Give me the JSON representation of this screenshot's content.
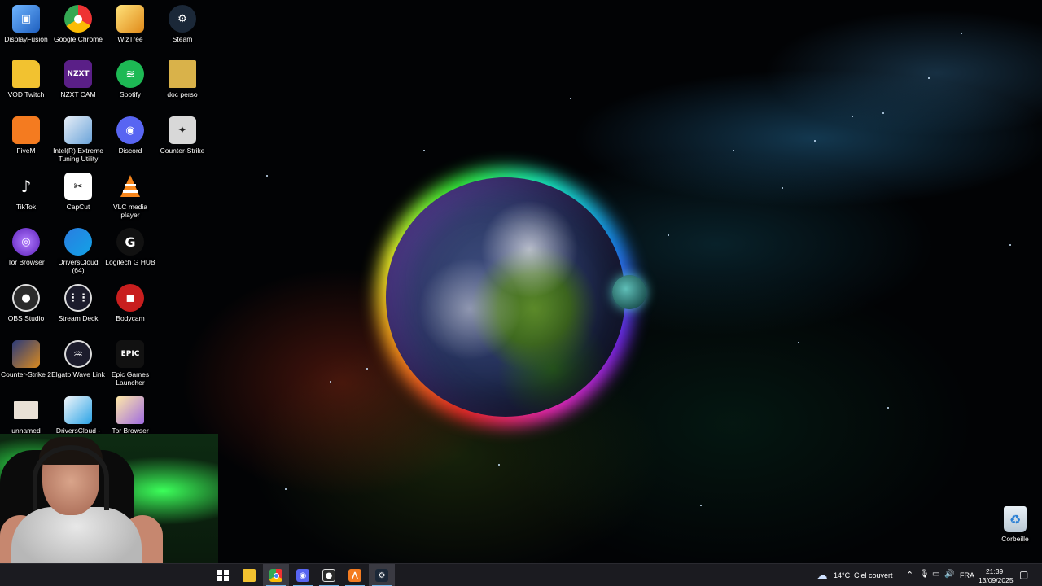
{
  "desktop_icons": [
    {
      "label": "DisplayFusion",
      "icon": "displayfusion-icon"
    },
    {
      "label": "VOD Twitch",
      "icon": "folder-icon"
    },
    {
      "label": "FiveM",
      "icon": "fivem-icon"
    },
    {
      "label": "TikTok",
      "icon": "tiktok-icon"
    },
    {
      "label": "Tor Browser",
      "icon": "tor-browser-icon"
    },
    {
      "label": "OBS Studio",
      "icon": "obs-icon"
    },
    {
      "label": "Counter-Strike 2",
      "icon": "cs2-icon"
    },
    {
      "label": "unnamed",
      "icon": "image-file-icon"
    },
    {
      "label": "Google Chrome",
      "icon": "chrome-icon"
    },
    {
      "label": "NZXT CAM",
      "icon": "nzxt-icon",
      "text": "NZXT"
    },
    {
      "label": "Intel(R) Extreme Tuning Utility",
      "icon": "intel-xtu-icon"
    },
    {
      "label": "CapCut",
      "icon": "capcut-icon"
    },
    {
      "label": "DriversCloud (64)",
      "icon": "driverscloud-icon"
    },
    {
      "label": "Stream Deck",
      "icon": "stream-deck-icon"
    },
    {
      "label": "Elgato Wave Link",
      "icon": "wave-link-icon"
    },
    {
      "label": "DriversCloud - Start the det...",
      "icon": "driverscloud-shortcut-icon"
    },
    {
      "label": "WizTree",
      "icon": "wiztree-icon"
    },
    {
      "label": "Spotify",
      "icon": "spotify-icon"
    },
    {
      "label": "Discord",
      "icon": "discord-icon"
    },
    {
      "label": "VLC media player",
      "icon": "vlc-icon"
    },
    {
      "label": "Logitech G HUB",
      "icon": "logitech-ghub-icon",
      "text": "G"
    },
    {
      "label": "Bodycam",
      "icon": "bodycam-icon"
    },
    {
      "label": "Epic Games Launcher",
      "icon": "epic-games-icon",
      "text": "EPIC"
    },
    {
      "label": "Tor Browser",
      "icon": "tor-browser-file-icon"
    },
    {
      "label": "Steam",
      "icon": "steam-icon"
    },
    {
      "label": "doc perso",
      "icon": "folder-zip-icon"
    },
    {
      "label": "Counter-Strike",
      "icon": "counter-strike-icon"
    }
  ],
  "recycle_bin": {
    "label": "Corbeille",
    "icon": "recycle-bin-icon"
  },
  "taskbar": {
    "apps": [
      {
        "icon": "windows-start-icon"
      },
      {
        "icon": "file-explorer-icon"
      },
      {
        "icon": "chrome-icon",
        "active": true
      },
      {
        "icon": "discord-icon"
      },
      {
        "icon": "obs-icon"
      },
      {
        "icon": "fivem-icon"
      },
      {
        "icon": "steam-icon",
        "active": true
      }
    ],
    "weather": {
      "temp": "14°C",
      "condition": "Ciel couvert",
      "icon": "cloudy-weather-icon"
    },
    "language": "FRA",
    "time": "21:39",
    "date": "13/09/2025"
  },
  "colors": {
    "taskbar_bg": "#1b1b20",
    "taskbar_active": "#3a3a42",
    "running_indicator": "#76b9ed"
  }
}
